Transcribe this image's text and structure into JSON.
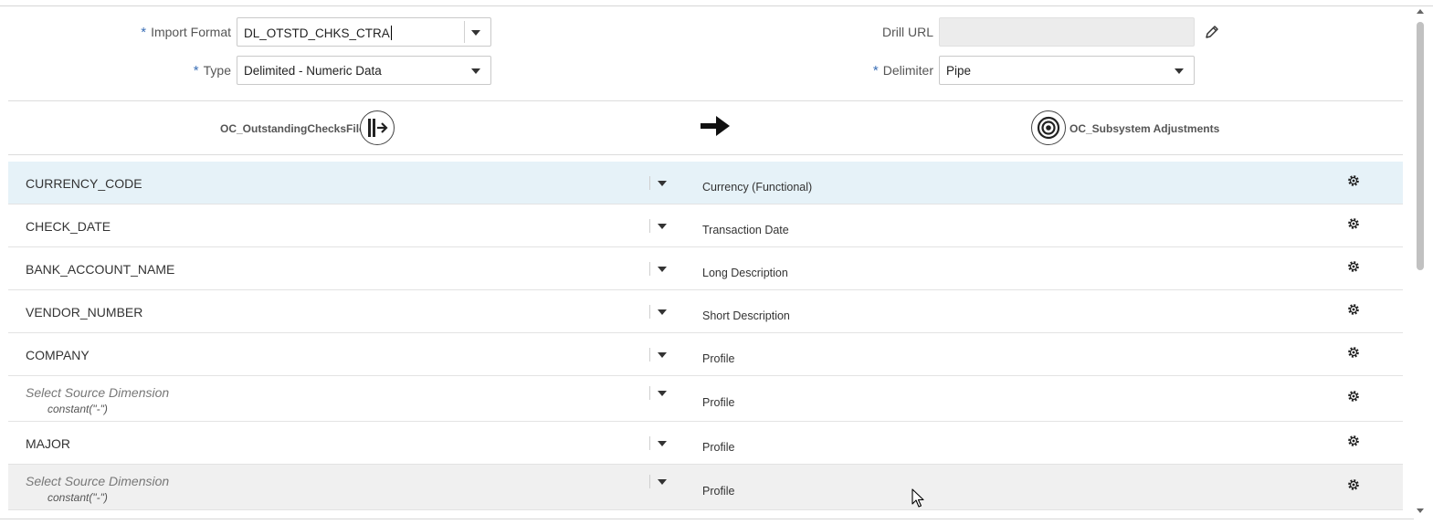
{
  "form": {
    "import_format": {
      "label": "Import Format",
      "required_mark": "*",
      "value": "DL_OTSTD_CHKS_CTRA"
    },
    "type": {
      "label": "Type",
      "required_mark": "*",
      "value": "Delimited - Numeric Data"
    },
    "drill_url": {
      "label": "Drill URL",
      "value": ""
    },
    "delimiter": {
      "label": "Delimiter",
      "required_mark": "*",
      "value": "Pipe"
    }
  },
  "mapping": {
    "source_name": "OC_OutstandingChecksFile",
    "target_name": "OC_Subsystem Adjustments",
    "rows": [
      {
        "source": "CURRENCY_CODE",
        "target": "Currency (Functional)"
      },
      {
        "source": "CHECK_DATE",
        "target": "Transaction Date"
      },
      {
        "source": "BANK_ACCOUNT_NAME",
        "target": "Long Description"
      },
      {
        "source": "VENDOR_NUMBER",
        "target": "Short Description"
      },
      {
        "source": "COMPANY",
        "target": "Profile"
      },
      {
        "source": "Select Source Dimension",
        "expression": "constant(\"-\")",
        "target": "Profile"
      },
      {
        "source": "MAJOR",
        "target": "Profile"
      },
      {
        "source": "Select Source Dimension",
        "expression": "constant(\"-\")",
        "target": "Profile"
      }
    ]
  },
  "colors": {
    "required": "#3b6fb6",
    "selected_row": "#e6f2f8",
    "hover_row": "#f0f0f0"
  },
  "icons": [
    "dropdown-caret-icon",
    "pencil-icon",
    "source-file-icon",
    "arrow-right-icon",
    "target-icon",
    "gear-icon",
    "mouse-cursor-icon"
  ]
}
